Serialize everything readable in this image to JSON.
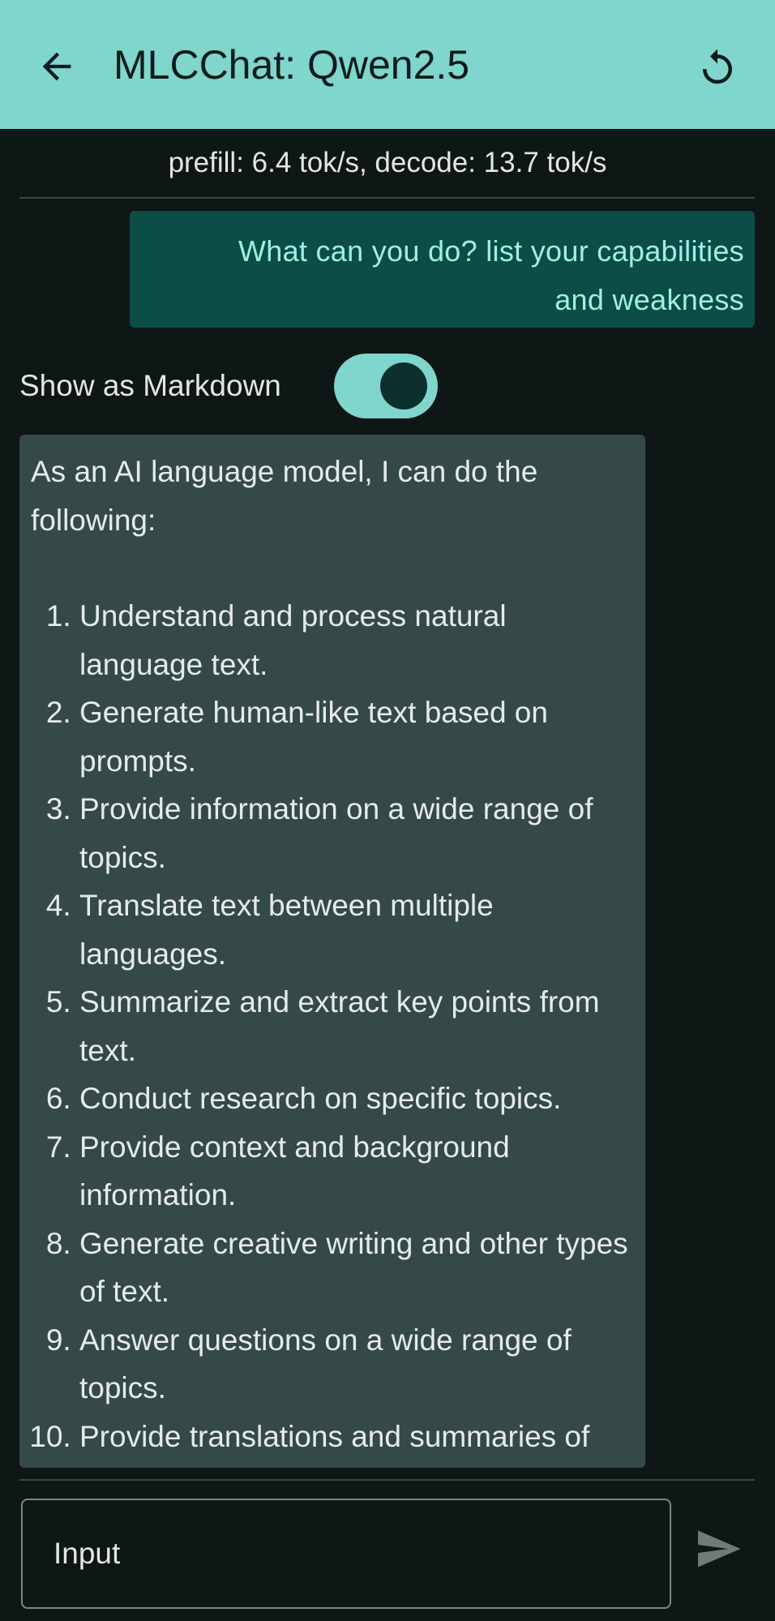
{
  "header": {
    "title": "MLCChat: Qwen2.5",
    "back_icon": "arrow-back-icon",
    "reset_icon": "restart-icon",
    "background_color": "#80d5cc"
  },
  "stats": {
    "text": "prefill: 6.4 tok/s, decode: 13.7 tok/s"
  },
  "messages": {
    "user": {
      "text": "What can you do? list your capabilities and weakness"
    },
    "markdown_toggle": {
      "label": "Show as Markdown",
      "on": true
    },
    "assistant": {
      "intro": "As an AI language model, I can do the following:",
      "items": [
        "Understand and process natural language text.",
        "Generate human-like text based on prompts.",
        "Provide information on a wide range of topics.",
        "Translate text between multiple languages.",
        "Summarize and extract key points from text.",
        "Conduct research on specific topics.",
        "Provide context and background information.",
        "Generate creative writing and other types of text.",
        "Answer questions on a wide range of topics.",
        "Provide translations and summaries of text."
      ]
    }
  },
  "composer": {
    "placeholder": "Input",
    "send_icon": "send-icon"
  },
  "colors": {
    "background": "#0f1616",
    "user_bubble": "#0d4d47",
    "user_text": "#9ef0e6",
    "assistant_bubble": "#344948",
    "accent": "#80d5cc"
  }
}
